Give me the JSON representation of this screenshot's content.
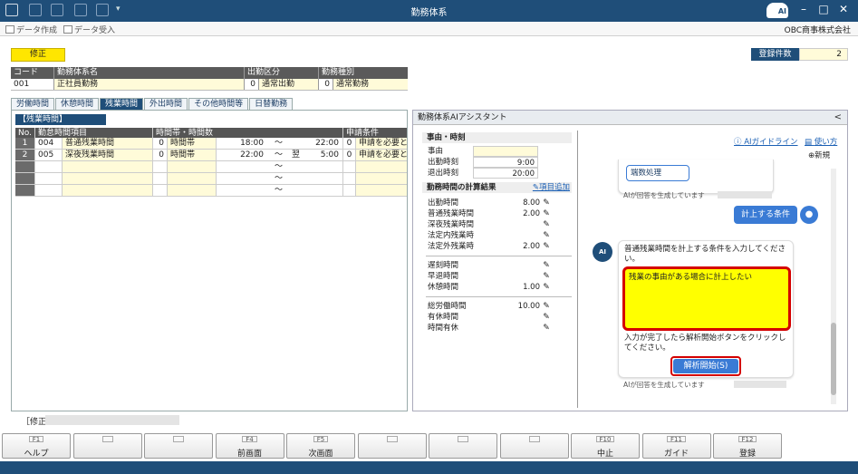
{
  "window": {
    "title": "勤務体系",
    "min": "–",
    "max": "□",
    "close": "✕"
  },
  "toolbar": {
    "create": "データ作成",
    "import": "データ受入",
    "company": "OBC商事株式会社"
  },
  "mode": "修正",
  "reg": {
    "label": "登録件数",
    "value": "2"
  },
  "header": {
    "cols": [
      "コード",
      "勤務体系名",
      "出勤区分",
      "勤務種別"
    ],
    "row": {
      "code": "001",
      "name": "正社員勤務",
      "att_no": "0",
      "att": "通常出勤",
      "type_no": "0",
      "type": "通常勤務"
    }
  },
  "tabs": [
    "労働時間",
    "休憩時間",
    "残業時間",
    "外出時間",
    "その他時間等",
    "日替勤務"
  ],
  "section_title": "【残業時間】",
  "grid": {
    "headers": [
      "No.",
      "勤怠時間項目",
      "時間帯・時間数",
      "申請条件"
    ],
    "rows": [
      {
        "no": "1",
        "code": "004",
        "item": "普通残業時間",
        "k": "0",
        "kind": "時間帯",
        "from": "18:00",
        "tilde": "〜",
        "next": "",
        "to": "22:00",
        "cno": "0",
        "cond": "申請を必要と"
      },
      {
        "no": "2",
        "code": "005",
        "item": "深夜残業時間",
        "k": "0",
        "kind": "時間帯",
        "from": "22:00",
        "tilde": "〜",
        "next": "翌",
        "to": "5:00",
        "cno": "0",
        "cond": "申請を必要と"
      },
      {
        "no": "",
        "code": "",
        "item": "",
        "k": "",
        "kind": "",
        "from": "",
        "tilde": "〜",
        "next": "",
        "to": "",
        "cno": "",
        "cond": ""
      },
      {
        "no": "",
        "code": "",
        "item": "",
        "k": "",
        "kind": "",
        "from": "",
        "tilde": "〜",
        "next": "",
        "to": "",
        "cno": "",
        "cond": ""
      },
      {
        "no": "",
        "code": "",
        "item": "",
        "k": "",
        "kind": "",
        "from": "",
        "tilde": "〜",
        "next": "",
        "to": "",
        "cno": "",
        "cond": ""
      }
    ]
  },
  "assistant": {
    "title": "勤務体系AIアシスタント",
    "collapse": "<",
    "reason_section": "事由・時刻",
    "reason": [
      {
        "k": "事由",
        "v": ""
      },
      {
        "k": "出勤時刻",
        "v": "9:00"
      },
      {
        "k": "退出時刻",
        "v": "20:00"
      }
    ],
    "calc_section": "勤務時間の計算結果",
    "add_item": "項目追加",
    "calc1": [
      {
        "k": "出勤時間",
        "v": "8.00"
      },
      {
        "k": "普通残業時間",
        "v": "2.00"
      },
      {
        "k": "深夜残業時間",
        "v": ""
      },
      {
        "k": "法定内残業時",
        "v": ""
      },
      {
        "k": "法定外残業時",
        "v": "2.00"
      }
    ],
    "calc2": [
      {
        "k": "遅刻時間",
        "v": ""
      },
      {
        "k": "早退時間",
        "v": ""
      },
      {
        "k": "休憩時間",
        "v": "1.00"
      }
    ],
    "calc3": [
      {
        "k": "総労働時間",
        "v": "10.00"
      },
      {
        "k": "有休時間",
        "v": ""
      },
      {
        "k": "時間有休",
        "v": ""
      }
    ],
    "guide": "AIガイドライン",
    "howto": "使い方",
    "new": "新規",
    "chip_rounding": "端数処理",
    "ai_note": "AIが回答を生成しています",
    "user_msg": "計上する条件",
    "ai_msg1": "普通残業時間を計上する条件を入力してください。",
    "input_text": "残業の事由がある場合に計上したい",
    "ai_msg2": "入力が完了したら解析開始ボタンをクリックしてください。",
    "analyze": "解析開始(S)"
  },
  "status": "［修正",
  "fkeys": [
    {
      "key": "F1",
      "label": "ヘルプ"
    },
    {
      "key": "",
      "label": ""
    },
    {
      "key": "",
      "label": ""
    },
    {
      "key": "F4",
      "label": "前画面"
    },
    {
      "key": "F5",
      "label": "次画面"
    },
    {
      "key": "",
      "label": ""
    },
    {
      "key": "",
      "label": ""
    },
    {
      "key": "",
      "label": ""
    },
    {
      "key": "F10",
      "label": "中止"
    },
    {
      "key": "F11",
      "label": "ガイド"
    },
    {
      "key": "F12",
      "label": "登録"
    }
  ],
  "colors": {
    "navy": "#1f4e79",
    "highlight": "#ffff00",
    "alert": "#d40000",
    "accent": "#3a7bd5"
  }
}
